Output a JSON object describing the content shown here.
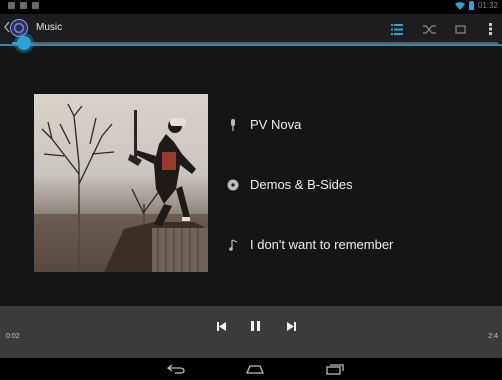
{
  "status_bar": {
    "left_icons": [
      "notification-icon",
      "image-icon",
      "download-icon"
    ],
    "right_icons": [
      "wifi-icon",
      "battery-icon"
    ],
    "clock": "01:32"
  },
  "action_bar": {
    "title": "Music",
    "actions": [
      "playlist-icon",
      "shuffle-icon",
      "repeat-icon",
      "overflow-menu-icon"
    ]
  },
  "track": {
    "artist": "PV Nova",
    "album": "Demos & B-Sides",
    "title": "I don't want to remember"
  },
  "playback": {
    "elapsed": "0:02",
    "duration": "2:4",
    "progress": 0.01
  },
  "nav_bar": {
    "buttons": [
      "back-icon",
      "home-icon",
      "recent-apps-icon"
    ]
  },
  "colors": {
    "accent": "#2ba3d6",
    "actionbar": "#1c1d1f",
    "controls": "#3a3b3d"
  }
}
